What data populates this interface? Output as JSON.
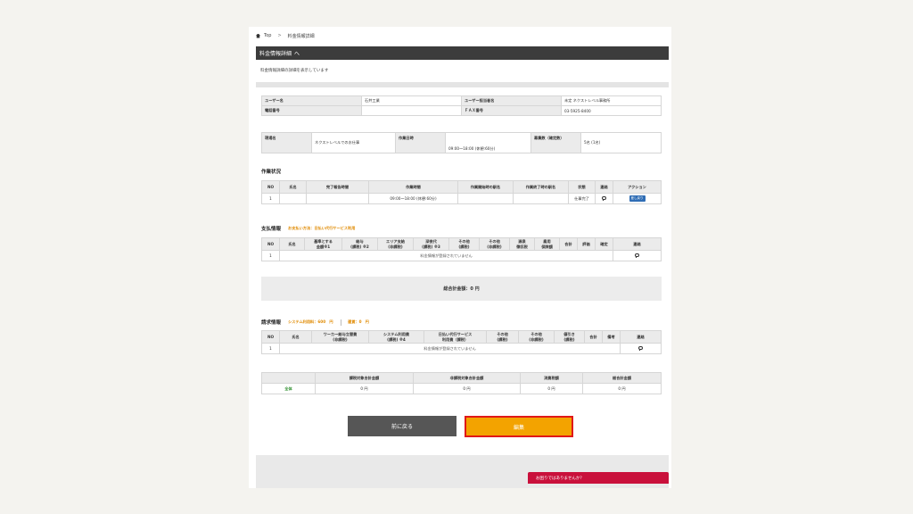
{
  "breadcrumb": {
    "home": "Top",
    "separator": ">",
    "current": "料金情報詳細"
  },
  "header": {
    "title": "料金情報詳細",
    "chevron": "へ"
  },
  "description": "料金情報詳細の詳細を表示しています",
  "user_info": {
    "user_name_label": "ユーザー名",
    "user_name": "石井工業",
    "person_label": "ユーザー担当者名",
    "person": "未定 ネクストレベル事務所",
    "phone_label": "電話番号",
    "phone": "",
    "fax_label": "ＦＡＸ番号",
    "fax": "03-5925-8400"
  },
  "site_info": {
    "site_label": "現場名",
    "site": "ネクストレベルでのお仕事",
    "date_label": "作業日時",
    "date": "09:00～18:00 (休憩:60分)",
    "count_label": "募集数（確定数）",
    "count": "5名 (1名)"
  },
  "work_status": {
    "title": "作業状況",
    "headers": [
      "NO",
      "氏名",
      "完了報告時間",
      "作業時間",
      "作業開始時の駅名",
      "作業終了時の駅名",
      "状態",
      "連絡",
      "アクション"
    ],
    "rows": [
      {
        "no": "1",
        "name": "",
        "report": "",
        "time": "09:00～18:00 (休憩:60分)",
        "start": "",
        "end": "",
        "status": "仕事完了",
        "action": "差し戻り"
      }
    ]
  },
  "payment": {
    "title": "支払情報",
    "method": "お支払い方法：日払い代行サービス利用",
    "headers": [
      "NO",
      "氏名",
      "基準とする\n金額※1",
      "給与\n(課税) ※2",
      "エリア支給\n(非課税)",
      "深夜代\n(課税) ※3",
      "その他\n(課税)",
      "その他\n(非課税)",
      "源泉\n徴収税",
      "雇用\n保険額",
      "合計",
      "評価",
      "確定",
      "連絡"
    ],
    "no": "1",
    "empty": "料金情報が登録されていません",
    "total": "総合計金額：0 円"
  },
  "billing": {
    "title": "請求情報",
    "system_fee": "システム利用料：600　円",
    "transport": "運賃：0　円",
    "headers": [
      "NO",
      "氏名",
      "ワーカー給与立替費\n(非課税)",
      "システム利用費\n(課税) ※4",
      "日払い代行サービス\n利用費（課税）",
      "その他\n(課税)",
      "その他\n(非課税)",
      "値引き\n(課税)",
      "合計",
      "備考",
      "連絡"
    ],
    "no": "1",
    "empty": "料金情報が登録されていません"
  },
  "summary": {
    "headers": [
      "",
      "課税対象合計金額",
      "非課税対象合計金額",
      "消費税額",
      "総合計金額"
    ],
    "row_label": "全体",
    "values": [
      "0 円",
      "0 円",
      "0 円",
      "0 円"
    ]
  },
  "buttons": {
    "back": "前に戻る",
    "edit": "編集"
  },
  "help": "お困りではありませんか？",
  "colors": {
    "accent": "#f3a300",
    "highlight": "#e01818",
    "help": "#c9103b"
  }
}
